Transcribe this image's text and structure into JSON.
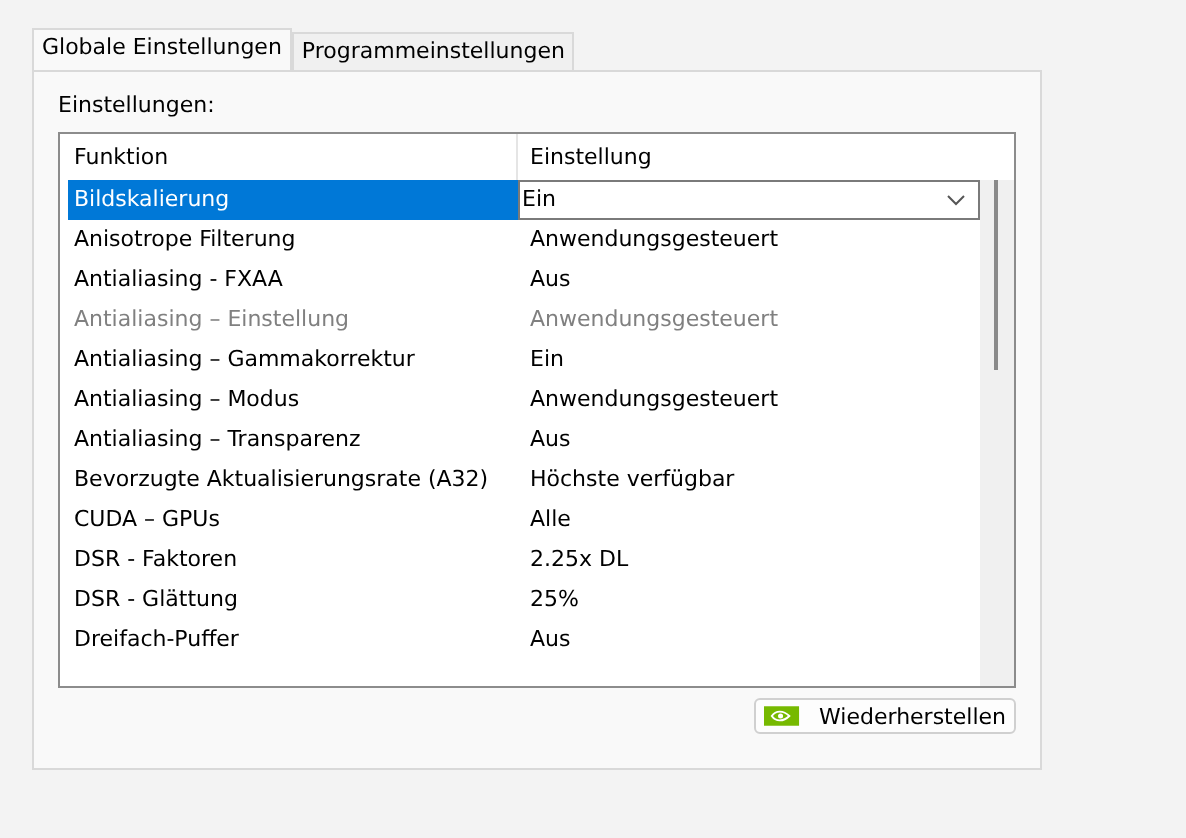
{
  "tabs": [
    {
      "label": "Globale Einstellungen",
      "selected": true
    },
    {
      "label": "Programmeinstellungen",
      "selected": false
    }
  ],
  "settings_label": "Einstellungen:",
  "table": {
    "columns": [
      "Funktion",
      "Einstellung"
    ],
    "rows": [
      {
        "function": "Bildskalierung",
        "value": "Ein",
        "selected": true,
        "disabled": false,
        "kind": "dropdown"
      },
      {
        "function": "Anisotrope Filterung",
        "value": "Anwendungsgesteuert",
        "selected": false,
        "disabled": false,
        "kind": "text"
      },
      {
        "function": "Antialiasing - FXAA",
        "value": "Aus",
        "selected": false,
        "disabled": false,
        "kind": "text"
      },
      {
        "function": "Antialiasing – Einstellung",
        "value": "Anwendungsgesteuert",
        "selected": false,
        "disabled": true,
        "kind": "text"
      },
      {
        "function": "Antialiasing – Gammakorrektur",
        "value": "Ein",
        "selected": false,
        "disabled": false,
        "kind": "text"
      },
      {
        "function": "Antialiasing – Modus",
        "value": "Anwendungsgesteuert",
        "selected": false,
        "disabled": false,
        "kind": "text"
      },
      {
        "function": "Antialiasing – Transparenz",
        "value": "Aus",
        "selected": false,
        "disabled": false,
        "kind": "text"
      },
      {
        "function": "Bevorzugte Aktualisierungsrate (A32)",
        "value": "Höchste verfügbar",
        "selected": false,
        "disabled": false,
        "kind": "text"
      },
      {
        "function": "CUDA – GPUs",
        "value": "Alle",
        "selected": false,
        "disabled": false,
        "kind": "text"
      },
      {
        "function": "DSR - Faktoren",
        "value": "2.25x DL",
        "selected": false,
        "disabled": false,
        "kind": "text"
      },
      {
        "function": "DSR - Glättung",
        "value": "25%",
        "selected": false,
        "disabled": false,
        "kind": "text"
      },
      {
        "function": "Dreifach-Puffer",
        "value": "Aus",
        "selected": false,
        "disabled": false,
        "kind": "text"
      }
    ]
  },
  "restore_button": "Wiederherstellen"
}
